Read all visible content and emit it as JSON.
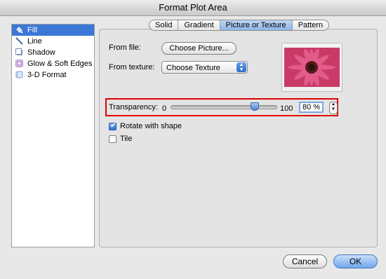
{
  "window": {
    "title": "Format Plot Area"
  },
  "sidebar": {
    "items": [
      {
        "label": "Fill",
        "icon": "paint-bucket-icon",
        "selected": true
      },
      {
        "label": "Line",
        "icon": "line-icon",
        "selected": false
      },
      {
        "label": "Shadow",
        "icon": "shadow-icon",
        "selected": false
      },
      {
        "label": "Glow & Soft Edges",
        "icon": "glow-icon",
        "selected": false
      },
      {
        "label": "3-D Format",
        "icon": "cube-icon",
        "selected": false
      }
    ]
  },
  "tabs": [
    {
      "label": "Solid",
      "active": false
    },
    {
      "label": "Gradient",
      "active": false
    },
    {
      "label": "Picture or Texture",
      "active": true
    },
    {
      "label": "Pattern",
      "active": false
    }
  ],
  "fill": {
    "from_file_label": "From file:",
    "choose_picture_label": "Choose Picture...",
    "from_texture_label": "From texture:",
    "texture_value": "Choose Texture",
    "preview_icon": "flower-thumbnail"
  },
  "transparency": {
    "label": "Transparency:",
    "min_label": "0",
    "max_label": "100",
    "value_text": "80 %",
    "value_fraction": 0.8
  },
  "options": {
    "rotate_label": "Rotate with shape",
    "rotate_checked": true,
    "tile_label": "Tile",
    "tile_checked": false
  },
  "buttons": {
    "cancel": "Cancel",
    "ok": "OK"
  },
  "colors": {
    "accent": "#3b78d6",
    "highlight": "#e00000",
    "flower": "#d93f73"
  }
}
